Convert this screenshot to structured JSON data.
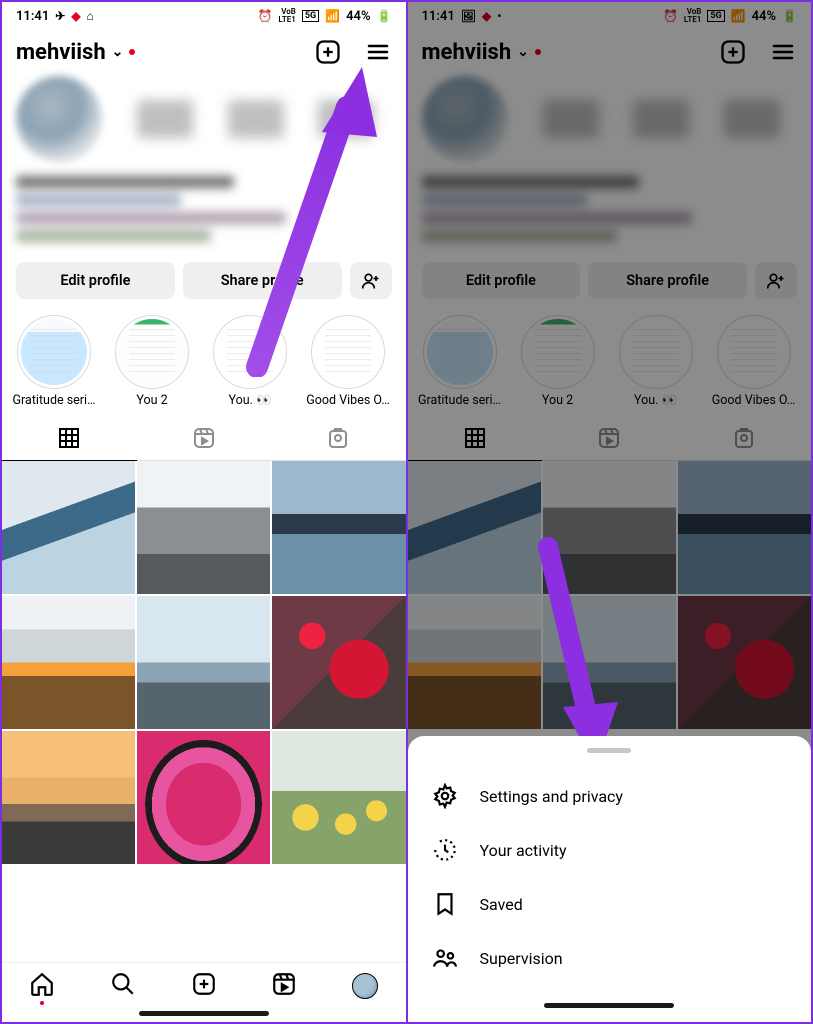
{
  "statusbar": {
    "time": "11:41",
    "net_label1": "VoB",
    "net_label2": "LTE1",
    "net_label3": "5G",
    "battery_pct": "44%"
  },
  "header": {
    "username": "mehviish"
  },
  "actions": {
    "edit_profile": "Edit profile",
    "share_profile": "Share profile"
  },
  "highlights": [
    {
      "label": "Gratitude seri…"
    },
    {
      "label": "You 2"
    },
    {
      "label": "You. 👀"
    },
    {
      "label": "Good Vibes O…"
    }
  ],
  "sheet": {
    "items": [
      {
        "icon": "gear",
        "label": "Settings and privacy"
      },
      {
        "icon": "activity",
        "label": "Your activity"
      },
      {
        "icon": "bookmark",
        "label": "Saved"
      },
      {
        "icon": "supervision",
        "label": "Supervision"
      }
    ]
  }
}
